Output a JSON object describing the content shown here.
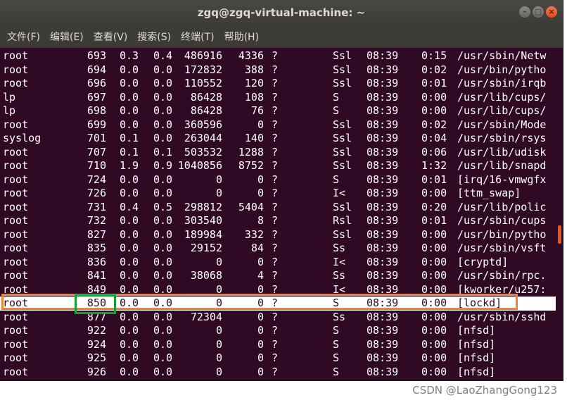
{
  "window": {
    "title": "zgq@zgq-virtual-machine: ~"
  },
  "menu": [
    "文件(F)",
    "编辑(E)",
    "查看(V)",
    "搜索(S)",
    "终端(T)",
    "帮助(H)"
  ],
  "processes": [
    {
      "user": "root",
      "pid": "693",
      "cpu": "0.3",
      "mem": "0.4",
      "vsz": "486916",
      "rss": "4336",
      "tty": "?",
      "stat": "Ssl",
      "start": "08:39",
      "time": "0:15",
      "cmd": "/usr/sbin/Netw"
    },
    {
      "user": "root",
      "pid": "694",
      "cpu": "0.0",
      "mem": "0.0",
      "vsz": "172832",
      "rss": "388",
      "tty": "?",
      "stat": "Ssl",
      "start": "08:39",
      "time": "0:02",
      "cmd": "/usr/bin/pytho"
    },
    {
      "user": "root",
      "pid": "696",
      "cpu": "0.0",
      "mem": "0.0",
      "vsz": "110552",
      "rss": "120",
      "tty": "?",
      "stat": "Ssl",
      "start": "08:39",
      "time": "0:01",
      "cmd": "/usr/sbin/irqb"
    },
    {
      "user": "lp",
      "pid": "697",
      "cpu": "0.0",
      "mem": "0.0",
      "vsz": "86428",
      "rss": "108",
      "tty": "?",
      "stat": "S",
      "start": "08:39",
      "time": "0:00",
      "cmd": "/usr/lib/cups/"
    },
    {
      "user": "lp",
      "pid": "698",
      "cpu": "0.0",
      "mem": "0.0",
      "vsz": "86428",
      "rss": "76",
      "tty": "?",
      "stat": "S",
      "start": "08:39",
      "time": "0:00",
      "cmd": "/usr/lib/cups/"
    },
    {
      "user": "root",
      "pid": "699",
      "cpu": "0.0",
      "mem": "0.0",
      "vsz": "360596",
      "rss": "0",
      "tty": "?",
      "stat": "Ssl",
      "start": "08:39",
      "time": "0:02",
      "cmd": "/usr/sbin/Mode"
    },
    {
      "user": "syslog",
      "pid": "701",
      "cpu": "0.1",
      "mem": "0.0",
      "vsz": "263044",
      "rss": "140",
      "tty": "?",
      "stat": "Ssl",
      "start": "08:39",
      "time": "0:04",
      "cmd": "/usr/sbin/rsys"
    },
    {
      "user": "root",
      "pid": "707",
      "cpu": "0.1",
      "mem": "0.1",
      "vsz": "503532",
      "rss": "1288",
      "tty": "?",
      "stat": "Ssl",
      "start": "08:39",
      "time": "0:06",
      "cmd": "/usr/lib/udisk"
    },
    {
      "user": "root",
      "pid": "710",
      "cpu": "1.9",
      "mem": "0.9",
      "vsz": "1040856",
      "rss": "8752",
      "tty": "?",
      "stat": "Ssl",
      "start": "08:39",
      "time": "1:32",
      "cmd": "/usr/lib/snapd"
    },
    {
      "user": "root",
      "pid": "724",
      "cpu": "0.0",
      "mem": "0.0",
      "vsz": "0",
      "rss": "0",
      "tty": "?",
      "stat": "S",
      "start": "08:39",
      "time": "0:01",
      "cmd": "[irq/16-vmwgfx"
    },
    {
      "user": "root",
      "pid": "726",
      "cpu": "0.0",
      "mem": "0.0",
      "vsz": "0",
      "rss": "0",
      "tty": "?",
      "stat": "I<",
      "start": "08:39",
      "time": "0:00",
      "cmd": "[ttm_swap]"
    },
    {
      "user": "root",
      "pid": "731",
      "cpu": "0.4",
      "mem": "0.5",
      "vsz": "298812",
      "rss": "5404",
      "tty": "?",
      "stat": "Ssl",
      "start": "08:39",
      "time": "0:20",
      "cmd": "/usr/lib/polic"
    },
    {
      "user": "root",
      "pid": "732",
      "cpu": "0.0",
      "mem": "0.0",
      "vsz": "303540",
      "rss": "8",
      "tty": "?",
      "stat": "Rsl",
      "start": "08:39",
      "time": "0:01",
      "cmd": "/usr/sbin/cups"
    },
    {
      "user": "root",
      "pid": "827",
      "cpu": "0.0",
      "mem": "0.0",
      "vsz": "189984",
      "rss": "332",
      "tty": "?",
      "stat": "Ssl",
      "start": "08:39",
      "time": "0:00",
      "cmd": "/usr/bin/pytho"
    },
    {
      "user": "root",
      "pid": "835",
      "cpu": "0.0",
      "mem": "0.0",
      "vsz": "29152",
      "rss": "84",
      "tty": "?",
      "stat": "Ss",
      "start": "08:39",
      "time": "0:00",
      "cmd": "/usr/sbin/vsft"
    },
    {
      "user": "root",
      "pid": "836",
      "cpu": "0.0",
      "mem": "0.0",
      "vsz": "0",
      "rss": "0",
      "tty": "?",
      "stat": "I<",
      "start": "08:39",
      "time": "0:00",
      "cmd": "[cryptd]"
    },
    {
      "user": "root",
      "pid": "841",
      "cpu": "0.0",
      "mem": "0.0",
      "vsz": "38068",
      "rss": "4",
      "tty": "?",
      "stat": "Ss",
      "start": "08:39",
      "time": "0:00",
      "cmd": "/usr/sbin/rpc."
    },
    {
      "user": "root",
      "pid": "849",
      "cpu": "0.0",
      "mem": "0.0",
      "vsz": "0",
      "rss": "0",
      "tty": "?",
      "stat": "I<",
      "start": "08:39",
      "time": "0:00",
      "cmd": "[kworker/u257:"
    },
    {
      "user": "root",
      "pid": "850",
      "cpu": "0.0",
      "mem": "0.0",
      "vsz": "0",
      "rss": "0",
      "tty": "?",
      "stat": "S",
      "start": "08:39",
      "time": "0:00",
      "cmd": "[lockd]",
      "highlighted": true
    },
    {
      "user": "root",
      "pid": "877",
      "cpu": "0.0",
      "mem": "0.0",
      "vsz": "72304",
      "rss": "0",
      "tty": "?",
      "stat": "Ss",
      "start": "08:39",
      "time": "0:00",
      "cmd": "/usr/sbin/sshd"
    },
    {
      "user": "root",
      "pid": "922",
      "cpu": "0.0",
      "mem": "0.0",
      "vsz": "0",
      "rss": "0",
      "tty": "?",
      "stat": "S",
      "start": "08:39",
      "time": "0:00",
      "cmd": "[nfsd]"
    },
    {
      "user": "root",
      "pid": "924",
      "cpu": "0.0",
      "mem": "0.0",
      "vsz": "0",
      "rss": "0",
      "tty": "?",
      "stat": "S",
      "start": "08:39",
      "time": "0:00",
      "cmd": "[nfsd]"
    },
    {
      "user": "root",
      "pid": "925",
      "cpu": "0.0",
      "mem": "0.0",
      "vsz": "0",
      "rss": "0",
      "tty": "?",
      "stat": "S",
      "start": "08:39",
      "time": "0:00",
      "cmd": "[nfsd]"
    },
    {
      "user": "root",
      "pid": "926",
      "cpu": "0.0",
      "mem": "0.0",
      "vsz": "0",
      "rss": "0",
      "tty": "?",
      "stat": "S",
      "start": "08:39",
      "time": "0:00",
      "cmd": "[nfsd]"
    }
  ],
  "watermark": "CSDN @LaoZhangGong123",
  "colors": {
    "terminal_bg": "#300a24",
    "annotation_orange": "#f5822a",
    "annotation_green": "#16a034",
    "scroll_thumb": "#e95420"
  }
}
